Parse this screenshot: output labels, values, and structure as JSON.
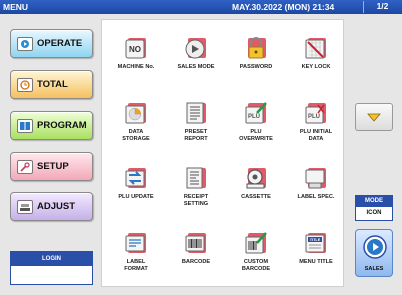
{
  "topbar": {
    "title": "MENU",
    "datetime": "MAY.30.2022 (MON)  21:34",
    "page": "1/2"
  },
  "nav": {
    "operate": "OPERATE",
    "total": "TOTAL",
    "program": "PROGRAM",
    "setup": "SETUP",
    "adjust": "ADJUST"
  },
  "login": {
    "label": "LOGIN",
    "value": ""
  },
  "menu_items": [
    {
      "label": "MACHINE No.",
      "icon": "machine-number-icon"
    },
    {
      "label": "SALES MODE",
      "icon": "sales-mode-icon"
    },
    {
      "label": "PASSWORD",
      "icon": "lock-icon"
    },
    {
      "label": "KEY LOCK",
      "icon": "key-lock-icon"
    },
    {
      "label": "DATA\nSTORAGE",
      "icon": "data-storage-icon"
    },
    {
      "label": "PRESET\nREPORT",
      "icon": "report-icon"
    },
    {
      "label": "PLU\nOVERWRITE",
      "icon": "plu-overwrite-icon"
    },
    {
      "label": "PLU INITIAL\nDATA",
      "icon": "plu-initial-icon"
    },
    {
      "label": "PLU UPDATE",
      "icon": "plu-update-icon"
    },
    {
      "label": "RECEIPT\nSETTING",
      "icon": "receipt-icon"
    },
    {
      "label": "CASSETTE",
      "icon": "cassette-icon"
    },
    {
      "label": "LABEL SPEC.",
      "icon": "label-spec-icon"
    },
    {
      "label": "LABEL\nFORMAT",
      "icon": "label-format-icon"
    },
    {
      "label": "BARCODE",
      "icon": "barcode-icon"
    },
    {
      "label": "CUSTOM\nBARCODE",
      "icon": "custom-barcode-icon"
    },
    {
      "label": "MENU TITLE",
      "icon": "menu-title-icon"
    }
  ],
  "mode": {
    "label": "MODE",
    "value": "ICON"
  },
  "sales_button": {
    "label": "SALES"
  },
  "colors": {
    "accent": "#2a4fa8",
    "topbar": "#2f62c4",
    "icon_red": "#e05a6a"
  }
}
